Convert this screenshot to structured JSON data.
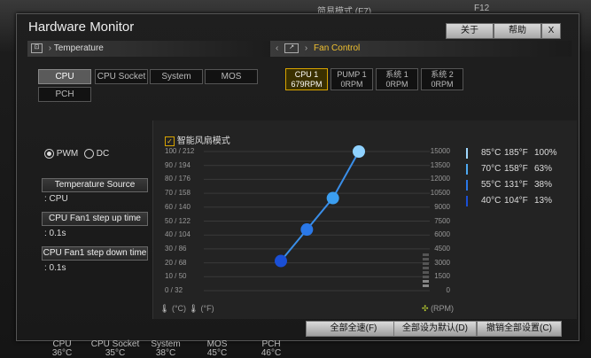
{
  "background": {
    "mode_label": "简易模式 (F7)",
    "right_text": "F12"
  },
  "window": {
    "title": "Hardware Monitor",
    "about": "关于",
    "help": "帮助",
    "close": "X"
  },
  "temperature": {
    "title": "Temperature",
    "tabs": [
      "CPU",
      "CPU Socket",
      "System",
      "MOS",
      "PCH"
    ],
    "selected": "CPU"
  },
  "fan_control": {
    "title": "Fan Control",
    "fans": [
      {
        "name": "CPU 1",
        "rpm": "679RPM",
        "selected": true
      },
      {
        "name": "PUMP 1",
        "rpm": "0RPM",
        "selected": false
      },
      {
        "name": "系统 1",
        "rpm": "0RPM",
        "selected": false
      },
      {
        "name": "系统 2",
        "rpm": "0RPM",
        "selected": false
      }
    ]
  },
  "mode": {
    "pwm": "PWM",
    "dc": "DC",
    "selected": "PWM"
  },
  "settings": [
    {
      "label": "Temperature Source",
      "value": ": CPU"
    },
    {
      "label": "CPU Fan1 step up time",
      "value": ": 0.1s"
    },
    {
      "label": "CPU Fan1 step down time",
      "value": ": 0.1s"
    }
  ],
  "smart_fan": {
    "label": "智能风扇模式",
    "checked": true
  },
  "chart_data": {
    "type": "line",
    "y_left_ticks": [
      "100 / 212",
      "90 / 194",
      "80 / 176",
      "70 / 158",
      "60 / 140",
      "50 / 122",
      "40 / 104",
      "30 / 86",
      "20 / 68",
      "10 / 50",
      "0 / 32"
    ],
    "y_right_ticks": [
      "15000",
      "13500",
      "12000",
      "10500",
      "9000",
      "7500",
      "6000",
      "4500",
      "3000",
      "1500",
      "0"
    ],
    "left_unit": "(°C)",
    "left_unit2": "(°F)",
    "right_unit": "(RPM)",
    "points": [
      {
        "temp_c": 40,
        "rpm": 1950
      },
      {
        "temp_c": 55,
        "rpm": 5700
      },
      {
        "temp_c": 70,
        "rpm": 9450
      },
      {
        "temp_c": 85,
        "rpm": 15000
      }
    ],
    "point_colors": [
      "#1a4fd6",
      "#2a78e8",
      "#3b9ef0",
      "#8fd2ff"
    ],
    "line_color": "#3a8ee8",
    "grid": true
  },
  "legend": [
    {
      "c": "85°C",
      "f": "185°F",
      "pct": "100%",
      "color": "#9fd8ff"
    },
    {
      "c": "70°C",
      "f": "158°F",
      "pct": "63%",
      "color": "#4ea9f2"
    },
    {
      "c": "55°C",
      "f": "131°F",
      "pct": "38%",
      "color": "#2a78e8"
    },
    {
      "c": "40°C",
      "f": "104°F",
      "pct": "13%",
      "color": "#1a4fd6"
    }
  ],
  "buttons": {
    "full_speed": "全部全速(F)",
    "default": "全部设为默认(D)",
    "cancel": "撤销全部设置(C)"
  },
  "bottom_readings": [
    {
      "name": "CPU",
      "value": "36°C"
    },
    {
      "name": "CPU Socket",
      "value": "35°C"
    },
    {
      "name": "System",
      "value": "38°C"
    },
    {
      "name": "MOS",
      "value": "45°C"
    },
    {
      "name": "PCH",
      "value": "46°C"
    }
  ]
}
